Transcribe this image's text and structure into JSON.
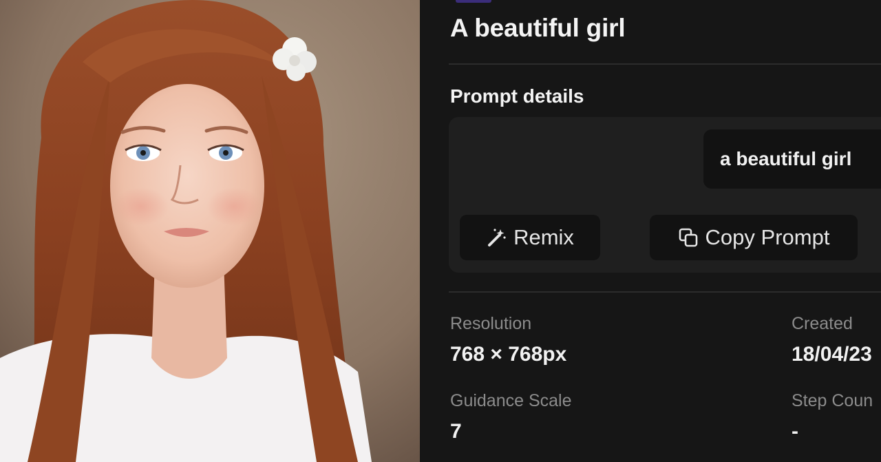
{
  "title": "A beautiful girl",
  "prompt_section": {
    "heading": "Prompt details",
    "prompt_text": "a beautiful girl",
    "remix_label": "Remix",
    "copy_label": "Copy Prompt"
  },
  "details": {
    "resolution": {
      "label": "Resolution",
      "value": "768 × 768px"
    },
    "created": {
      "label": "Created",
      "value": "18/04/23"
    },
    "guidance_scale": {
      "label": "Guidance Scale",
      "value": "7"
    },
    "step_count": {
      "label": "Step Coun",
      "value": "-"
    }
  },
  "icons": {
    "remix": "magic-wand-icon",
    "copy": "copy-icon"
  },
  "colors": {
    "panel_background": "#161616",
    "card_background": "#1f1f1f",
    "button_background": "#121212",
    "muted_text": "#8c8c8c",
    "accent": "#3b2d7a"
  }
}
